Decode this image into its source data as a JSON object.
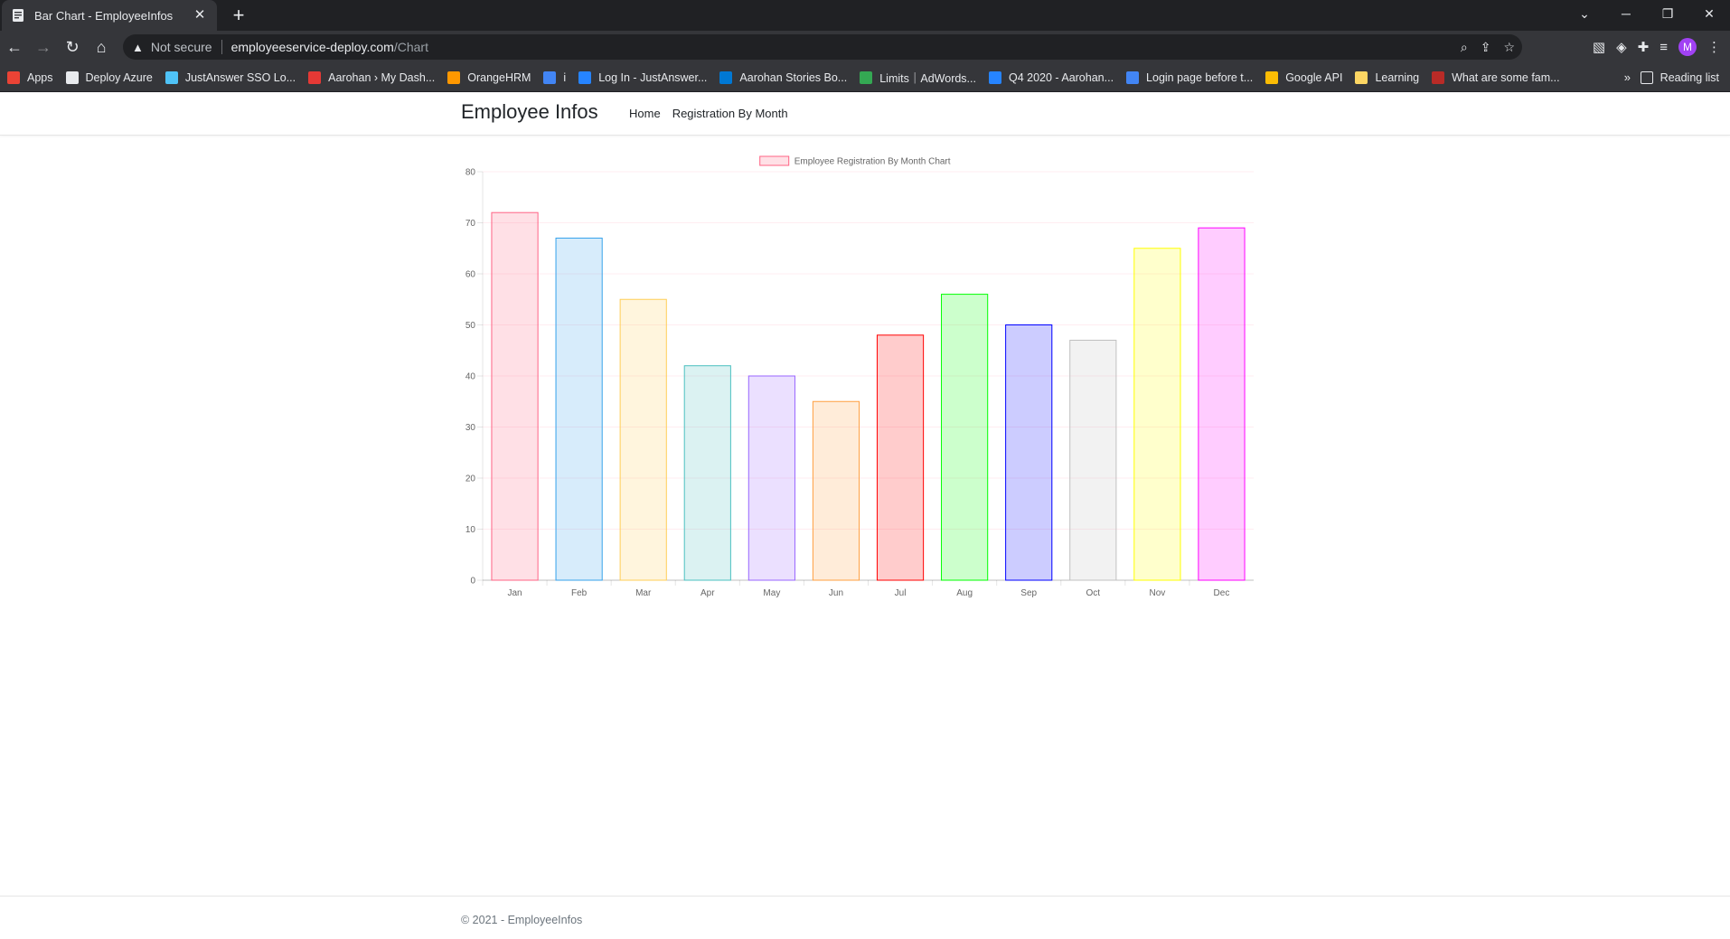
{
  "browser": {
    "tab_title": "Bar Chart - EmployeeInfos",
    "tab_close": "✕",
    "new_tab": "+",
    "security_label": "Not secure",
    "url_host": "employeeservice-deploy.com",
    "url_path": "/Chart",
    "bookmarks": [
      {
        "label": "Apps",
        "color": "#ea4335"
      },
      {
        "label": "Deploy Azure",
        "color": "#e8eaed"
      },
      {
        "label": "JustAnswer SSO Lo...",
        "color": "#4fc3f7"
      },
      {
        "label": "Aarohan › My Dash...",
        "color": "#e53935"
      },
      {
        "label": "OrangeHRM",
        "color": "#ff9800"
      },
      {
        "label": "i",
        "color": "#4285f4"
      },
      {
        "label": "Log In - JustAnswer...",
        "color": "#2684ff"
      },
      {
        "label": "Aarohan Stories Bo...",
        "color": "#0078d4"
      },
      {
        "label": "Limits｜AdWords...",
        "color": "#34a853"
      },
      {
        "label": "Q4 2020 - Aarohan...",
        "color": "#2684ff"
      },
      {
        "label": "Login page before t...",
        "color": "#4285f4"
      },
      {
        "label": "Google API",
        "color": "#fbbc04"
      },
      {
        "label": "Learning",
        "color": "#fdd663"
      },
      {
        "label": "What are some fam...",
        "color": "#b92b27"
      }
    ],
    "bookmarks_more": "»",
    "reading_list": "Reading list",
    "avatar_letter": "M"
  },
  "site": {
    "brand": "Employee Infos",
    "nav": [
      "Home",
      "Registration By Month"
    ],
    "footer": "© 2021 - EmployeeInfos"
  },
  "chart_data": {
    "type": "bar",
    "legend_label": "Employee Registration By Month Chart",
    "legend_position": "top",
    "categories": [
      "Jan",
      "Feb",
      "Mar",
      "Apr",
      "May",
      "Jun",
      "Jul",
      "Aug",
      "Sep",
      "Oct",
      "Nov",
      "Dec"
    ],
    "values": [
      72,
      67,
      55,
      42,
      40,
      35,
      48,
      56,
      50,
      47,
      65,
      69
    ],
    "ylim": [
      0,
      80
    ],
    "yticks": [
      0,
      10,
      20,
      30,
      40,
      50,
      60,
      70,
      80
    ],
    "grid": true,
    "fill_colors": [
      "rgba(255,99,132,0.2)",
      "rgba(54,162,235,0.2)",
      "rgba(255,206,86,0.2)",
      "rgba(75,192,192,0.2)",
      "rgba(153,102,255,0.2)",
      "rgba(255,159,64,0.2)",
      "rgba(255,0,0,0.2)",
      "rgba(0,255,0,0.2)",
      "rgba(0,0,255,0.2)",
      "rgba(192,192,192,0.2)",
      "rgba(255,255,0,0.2)",
      "rgba(255,0,255,0.2)"
    ],
    "border_colors": [
      "rgba(255,99,132,1)",
      "rgba(54,162,235,1)",
      "rgba(255,206,86,1)",
      "rgba(75,192,192,1)",
      "rgba(153,102,255,1)",
      "rgba(255,159,64,1)",
      "rgba(255,0,0,1)",
      "rgba(0,255,0,1)",
      "rgba(0,0,255,1)",
      "rgba(192,192,192,1)",
      "rgba(255,255,0,1)",
      "rgba(255,0,255,1)"
    ]
  }
}
